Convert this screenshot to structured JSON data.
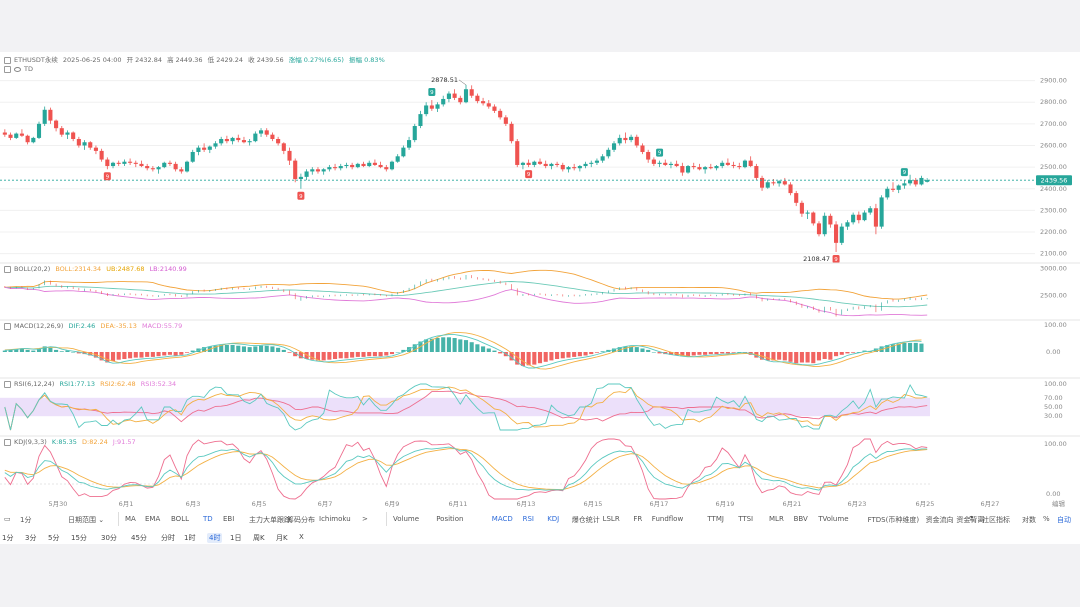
{
  "colors": {
    "up": "#26a69a",
    "down": "#ef5350",
    "boll_mid": "#f2a33a",
    "boll_up": "#6ccab8",
    "boll_lo": "#e07ad8",
    "ma_pink": "#ee6e8f",
    "ma_teal": "#5bc9c0",
    "ma_orange": "#f3b044",
    "rsi_band": "#ece0fa",
    "current": "#26a69a",
    "grid": "#f0f0f0"
  },
  "header": {
    "symbol": "ETHUSDT永续",
    "date": "2025-06-25 04:00",
    "open": "开 2432.84",
    "high": "高 2449.36",
    "low": "低 2429.24",
    "close": "收 2439.56",
    "change": "涨幅 0.27%(6.65)",
    "amplitude": "振幅 0.83%",
    "td": "TD"
  },
  "indicators": {
    "boll": {
      "name": "BOLL(20,2)",
      "mid": "BOLL:2314.34",
      "up": "UB:2487.68",
      "lo": "LB:2140.99"
    },
    "macd": {
      "name": "MACD(12,26,9)",
      "dif": "DIF:2.46",
      "dea": "DEA:-35.13",
      "macd": "MACD:55.79"
    },
    "rsi": {
      "name": "RSI(6,12,24)",
      "r1": "RSI1:77.13",
      "r2": "RSI2:62.48",
      "r3": "RSI3:52.34"
    },
    "kdj": {
      "name": "KDJ(9,3,3)",
      "k": "K:85.35",
      "d": "D:82.24",
      "j": "J:91.57"
    }
  },
  "chart_data": {
    "type": "candlestick",
    "x_axis_labels": [
      "5月30",
      "6月1",
      "6月3",
      "6月5",
      "6月7",
      "6月9",
      "6月11",
      "6月13",
      "6月15",
      "6月17",
      "6月19",
      "6月21",
      "6月23",
      "6月25",
      "6月27"
    ],
    "price_axis": [
      "2900.00",
      "2800.00",
      "2700.00",
      "2600.00",
      "2500.00",
      "2400.00",
      "2300.00",
      "2200.00",
      "2100.00"
    ],
    "ylim": [
      2080,
      2935
    ],
    "current_price": "2439.56",
    "annotations": {
      "high": "2878.51",
      "low": "2108.47",
      "td_marks": [
        "9",
        "9",
        "9",
        "9",
        "9",
        "9",
        "9"
      ]
    },
    "ohlc": [
      [
        2660,
        2675,
        2640,
        2650
      ],
      [
        2650,
        2660,
        2625,
        2635
      ],
      [
        2635,
        2660,
        2630,
        2655
      ],
      [
        2655,
        2675,
        2640,
        2645
      ],
      [
        2645,
        2650,
        2605,
        2615
      ],
      [
        2615,
        2640,
        2610,
        2635
      ],
      [
        2635,
        2710,
        2630,
        2700
      ],
      [
        2700,
        2780,
        2690,
        2765
      ],
      [
        2765,
        2775,
        2700,
        2715
      ],
      [
        2715,
        2720,
        2665,
        2680
      ],
      [
        2680,
        2690,
        2640,
        2650
      ],
      [
        2650,
        2670,
        2630,
        2660
      ],
      [
        2660,
        2665,
        2620,
        2630
      ],
      [
        2630,
        2640,
        2590,
        2600
      ],
      [
        2600,
        2625,
        2580,
        2615
      ],
      [
        2615,
        2620,
        2580,
        2590
      ],
      [
        2590,
        2600,
        2560,
        2575
      ],
      [
        2575,
        2585,
        2525,
        2535
      ],
      [
        2535,
        2545,
        2490,
        2505
      ],
      [
        2505,
        2525,
        2495,
        2520
      ],
      [
        2520,
        2530,
        2505,
        2515
      ],
      [
        2515,
        2535,
        2505,
        2525
      ],
      [
        2525,
        2540,
        2510,
        2520
      ],
      [
        2520,
        2530,
        2500,
        2515
      ],
      [
        2515,
        2530,
        2500,
        2505
      ],
      [
        2505,
        2515,
        2485,
        2495
      ],
      [
        2495,
        2505,
        2480,
        2490
      ],
      [
        2490,
        2505,
        2470,
        2500
      ],
      [
        2500,
        2525,
        2495,
        2520
      ],
      [
        2520,
        2530,
        2505,
        2515
      ],
      [
        2515,
        2525,
        2480,
        2490
      ],
      [
        2490,
        2500,
        2470,
        2480
      ],
      [
        2480,
        2530,
        2475,
        2525
      ],
      [
        2525,
        2580,
        2520,
        2570
      ],
      [
        2570,
        2600,
        2555,
        2590
      ],
      [
        2590,
        2610,
        2570,
        2580
      ],
      [
        2580,
        2600,
        2565,
        2595
      ],
      [
        2595,
        2620,
        2585,
        2610
      ],
      [
        2610,
        2640,
        2600,
        2630
      ],
      [
        2630,
        2645,
        2610,
        2620
      ],
      [
        2620,
        2640,
        2605,
        2635
      ],
      [
        2635,
        2650,
        2615,
        2625
      ],
      [
        2625,
        2640,
        2610,
        2615
      ],
      [
        2615,
        2630,
        2600,
        2620
      ],
      [
        2620,
        2665,
        2615,
        2655
      ],
      [
        2655,
        2680,
        2640,
        2670
      ],
      [
        2670,
        2680,
        2640,
        2650
      ],
      [
        2650,
        2660,
        2620,
        2630
      ],
      [
        2630,
        2640,
        2600,
        2610
      ],
      [
        2610,
        2615,
        2560,
        2575
      ],
      [
        2575,
        2590,
        2510,
        2530
      ],
      [
        2530,
        2540,
        2430,
        2445
      ],
      [
        2445,
        2470,
        2400,
        2455
      ],
      [
        2455,
        2490,
        2440,
        2480
      ],
      [
        2480,
        2500,
        2465,
        2490
      ],
      [
        2490,
        2500,
        2470,
        2480
      ],
      [
        2480,
        2495,
        2465,
        2490
      ],
      [
        2490,
        2510,
        2480,
        2500
      ],
      [
        2500,
        2515,
        2485,
        2495
      ],
      [
        2495,
        2515,
        2485,
        2505
      ],
      [
        2505,
        2520,
        2495,
        2510
      ],
      [
        2510,
        2520,
        2490,
        2500
      ],
      [
        2500,
        2520,
        2495,
        2515
      ],
      [
        2515,
        2525,
        2500,
        2505
      ],
      [
        2505,
        2530,
        2500,
        2520
      ],
      [
        2520,
        2535,
        2505,
        2510
      ],
      [
        2510,
        2525,
        2495,
        2500
      ],
      [
        2500,
        2510,
        2480,
        2490
      ],
      [
        2490,
        2530,
        2485,
        2525
      ],
      [
        2525,
        2560,
        2520,
        2550
      ],
      [
        2550,
        2600,
        2545,
        2590
      ],
      [
        2590,
        2640,
        2580,
        2625
      ],
      [
        2625,
        2700,
        2615,
        2690
      ],
      [
        2690,
        2760,
        2680,
        2745
      ],
      [
        2745,
        2800,
        2735,
        2785
      ],
      [
        2785,
        2810,
        2760,
        2770
      ],
      [
        2770,
        2800,
        2755,
        2790
      ],
      [
        2790,
        2830,
        2780,
        2815
      ],
      [
        2815,
        2850,
        2800,
        2840
      ],
      [
        2840,
        2860,
        2810,
        2820
      ],
      [
        2820,
        2830,
        2790,
        2800
      ],
      [
        2800,
        2880,
        2795,
        2860
      ],
      [
        2860,
        2878,
        2820,
        2830
      ],
      [
        2830,
        2840,
        2795,
        2805
      ],
      [
        2805,
        2820,
        2785,
        2795
      ],
      [
        2795,
        2810,
        2770,
        2780
      ],
      [
        2780,
        2790,
        2750,
        2760
      ],
      [
        2760,
        2770,
        2720,
        2730
      ],
      [
        2730,
        2740,
        2690,
        2700
      ],
      [
        2700,
        2710,
        2610,
        2620
      ],
      [
        2620,
        2630,
        2500,
        2510
      ],
      [
        2510,
        2525,
        2490,
        2520
      ],
      [
        2520,
        2535,
        2500,
        2510
      ],
      [
        2510,
        2530,
        2500,
        2525
      ],
      [
        2525,
        2540,
        2510,
        2515
      ],
      [
        2515,
        2530,
        2495,
        2505
      ],
      [
        2505,
        2520,
        2490,
        2515
      ],
      [
        2515,
        2525,
        2500,
        2510
      ],
      [
        2510,
        2520,
        2480,
        2490
      ],
      [
        2490,
        2505,
        2475,
        2500
      ],
      [
        2500,
        2515,
        2485,
        2495
      ],
      [
        2495,
        2510,
        2480,
        2505
      ],
      [
        2505,
        2525,
        2495,
        2515
      ],
      [
        2515,
        2530,
        2500,
        2520
      ],
      [
        2520,
        2540,
        2510,
        2530
      ],
      [
        2530,
        2560,
        2520,
        2550
      ],
      [
        2550,
        2590,
        2540,
        2580
      ],
      [
        2580,
        2620,
        2570,
        2610
      ],
      [
        2610,
        2650,
        2600,
        2635
      ],
      [
        2635,
        2660,
        2610,
        2625
      ],
      [
        2625,
        2650,
        2615,
        2640
      ],
      [
        2640,
        2650,
        2590,
        2600
      ],
      [
        2600,
        2610,
        2560,
        2570
      ],
      [
        2570,
        2580,
        2520,
        2535
      ],
      [
        2535,
        2545,
        2505,
        2515
      ],
      [
        2515,
        2530,
        2500,
        2520
      ],
      [
        2520,
        2535,
        2505,
        2510
      ],
      [
        2510,
        2525,
        2495,
        2515
      ],
      [
        2515,
        2530,
        2500,
        2505
      ],
      [
        2505,
        2520,
        2460,
        2475
      ],
      [
        2475,
        2510,
        2470,
        2505
      ],
      [
        2505,
        2520,
        2490,
        2500
      ],
      [
        2500,
        2515,
        2485,
        2490
      ],
      [
        2490,
        2505,
        2470,
        2500
      ],
      [
        2500,
        2515,
        2490,
        2495
      ],
      [
        2495,
        2510,
        2485,
        2505
      ],
      [
        2505,
        2530,
        2495,
        2520
      ],
      [
        2520,
        2540,
        2505,
        2510
      ],
      [
        2510,
        2525,
        2495,
        2505
      ],
      [
        2505,
        2520,
        2490,
        2500
      ],
      [
        2500,
        2535,
        2495,
        2530
      ],
      [
        2530,
        2550,
        2500,
        2505
      ],
      [
        2505,
        2515,
        2440,
        2450
      ],
      [
        2450,
        2460,
        2390,
        2405
      ],
      [
        2405,
        2440,
        2400,
        2430
      ],
      [
        2430,
        2445,
        2415,
        2425
      ],
      [
        2425,
        2440,
        2410,
        2435
      ],
      [
        2435,
        2450,
        2415,
        2420
      ],
      [
        2420,
        2430,
        2370,
        2380
      ],
      [
        2380,
        2390,
        2320,
        2335
      ],
      [
        2335,
        2345,
        2270,
        2285
      ],
      [
        2285,
        2300,
        2260,
        2290
      ],
      [
        2290,
        2295,
        2230,
        2240
      ],
      [
        2240,
        2250,
        2180,
        2190
      ],
      [
        2190,
        2290,
        2180,
        2275
      ],
      [
        2275,
        2285,
        2220,
        2235
      ],
      [
        2235,
        2250,
        2108,
        2150
      ],
      [
        2150,
        2240,
        2140,
        2225
      ],
      [
        2225,
        2255,
        2210,
        2245
      ],
      [
        2245,
        2290,
        2235,
        2280
      ],
      [
        2280,
        2295,
        2240,
        2255
      ],
      [
        2255,
        2300,
        2250,
        2290
      ],
      [
        2290,
        2320,
        2280,
        2310
      ],
      [
        2310,
        2330,
        2190,
        2225
      ],
      [
        2225,
        2370,
        2215,
        2360
      ],
      [
        2360,
        2410,
        2350,
        2400
      ],
      [
        2400,
        2430,
        2385,
        2395
      ],
      [
        2395,
        2420,
        2380,
        2415
      ],
      [
        2415,
        2440,
        2400,
        2425
      ],
      [
        2425,
        2465,
        2415,
        2440
      ],
      [
        2440,
        2450,
        2410,
        2420
      ],
      [
        2420,
        2460,
        2415,
        2450
      ],
      [
        2432,
        2449,
        2429,
        2440
      ]
    ],
    "macd_hist": [
      2,
      3,
      4,
      5,
      3,
      2,
      5,
      8,
      6,
      3,
      1,
      2,
      0,
      -2,
      -3,
      -5,
      -8,
      -12,
      -15,
      -13,
      -11,
      -10,
      -9,
      -8,
      -8,
      -7,
      -7,
      -6,
      -5,
      -4,
      -5,
      -4,
      -1,
      2,
      5,
      7,
      8,
      9,
      10,
      10,
      10,
      9,
      8,
      7,
      8,
      9,
      9,
      8,
      6,
      3,
      -1,
      -6,
      -9,
      -10,
      -11,
      -12,
      -12,
      -11,
      -10,
      -9,
      -9,
      -8,
      -7,
      -7,
      -6,
      -6,
      -6,
      -5,
      -3,
      0,
      3,
      7,
      11,
      15,
      18,
      19,
      20,
      21,
      21,
      20,
      18,
      17,
      14,
      11,
      8,
      5,
      2,
      -2,
      -6,
      -12,
      -18,
      -20,
      -19,
      -18,
      -16,
      -14,
      -12,
      -10,
      -9,
      -8,
      -7,
      -6,
      -5,
      -3,
      -1,
      1,
      3,
      5,
      7,
      8,
      8,
      7,
      5,
      3,
      0,
      -2,
      -3,
      -4,
      -5,
      -6,
      -6,
      -5,
      -4,
      -4,
      -3,
      -3,
      -2,
      -2,
      -1,
      0,
      -1,
      -4,
      -8,
      -11,
      -12,
      -12,
      -11,
      -12,
      -14,
      -16,
      -15,
      -15,
      -16,
      -12,
      -10,
      -11,
      -6,
      -4,
      -2,
      -1,
      0,
      2,
      1,
      5,
      8,
      10,
      11,
      12,
      13,
      13,
      13,
      12
    ]
  },
  "toolbar": {
    "interval_select": "1分",
    "period_select": "日期范围",
    "indicators_main": [
      "MA",
      "EMA",
      "BOLL",
      "TD",
      "EBI",
      "主力大单跟踪",
      "筹码分布",
      "Ichimoku"
    ],
    "indicators_sub": [
      "Volume",
      "Position",
      "MACD",
      "RSI",
      "KDJ",
      "爆仓统计",
      "LSLR",
      "FR",
      "Fundflow",
      "TTMJ",
      "TTSI",
      "MLR",
      "BBV",
      "TVolume",
      "FTDS(币种维度)",
      "资金流向",
      "资金背离"
    ],
    "right": [
      "社区指标",
      "对数",
      "%",
      "自动"
    ],
    "more": ">"
  },
  "timeframes": [
    "1分",
    "3分",
    "5分",
    "15分",
    "30分",
    "45分",
    "分时",
    "1时",
    "4时",
    "1日",
    "周K",
    "月K",
    "X"
  ],
  "selected_timeframe": "4时"
}
